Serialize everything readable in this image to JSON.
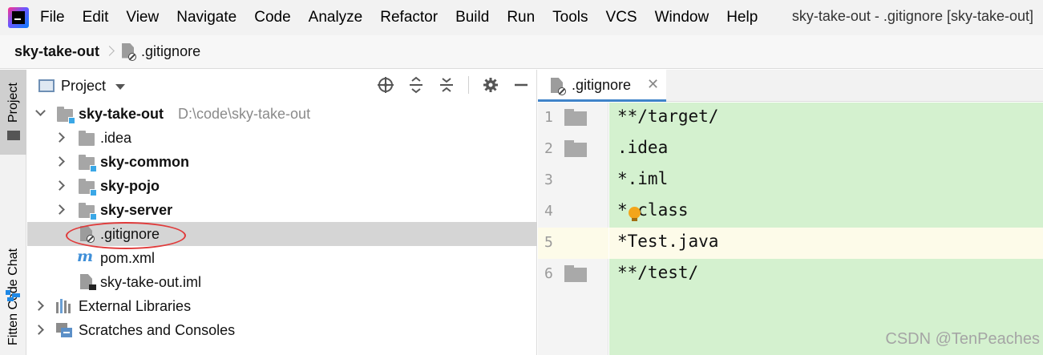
{
  "menu": {
    "items": [
      "File",
      "Edit",
      "View",
      "Navigate",
      "Code",
      "Analyze",
      "Refactor",
      "Build",
      "Run",
      "Tools",
      "VCS",
      "Window",
      "Help"
    ],
    "window_title": "sky-take-out - .gitignore [sky-take-out]"
  },
  "breadcrumb": {
    "project": "sky-take-out",
    "file": ".gitignore"
  },
  "toolstrip": {
    "project_label": "Project",
    "fitten_label": "Fitten Code Chat"
  },
  "project_panel": {
    "title": "Project",
    "tree": [
      {
        "label": "sky-take-out",
        "path": "D:\\code\\sky-take-out"
      },
      {
        "label": ".idea"
      },
      {
        "label": "sky-common"
      },
      {
        "label": "sky-pojo"
      },
      {
        "label": "sky-server"
      },
      {
        "label": ".gitignore"
      },
      {
        "label": "pom.xml"
      },
      {
        "label": "sky-take-out.iml"
      },
      {
        "label": "External Libraries"
      },
      {
        "label": "Scratches and Consoles"
      }
    ]
  },
  "editor": {
    "tab_label": ".gitignore",
    "lines": [
      {
        "number": "1",
        "text": "**/target/"
      },
      {
        "number": "2",
        "text": ".idea"
      },
      {
        "number": "3",
        "text": "*.iml"
      },
      {
        "number": "4",
        "text": "*.class"
      },
      {
        "number": "5",
        "text": "*Test.java"
      },
      {
        "number": "6",
        "text": "**/test/"
      }
    ],
    "current_line": "5"
  },
  "watermark": "CSDN @TenPeaches",
  "colors": {
    "code_background": "#d4f1cf",
    "current_line": "#fdfbe9",
    "selected_row": "#d5d5d5",
    "annotation_circle": "#e03a3a",
    "tab_underline": "#4083c9"
  }
}
